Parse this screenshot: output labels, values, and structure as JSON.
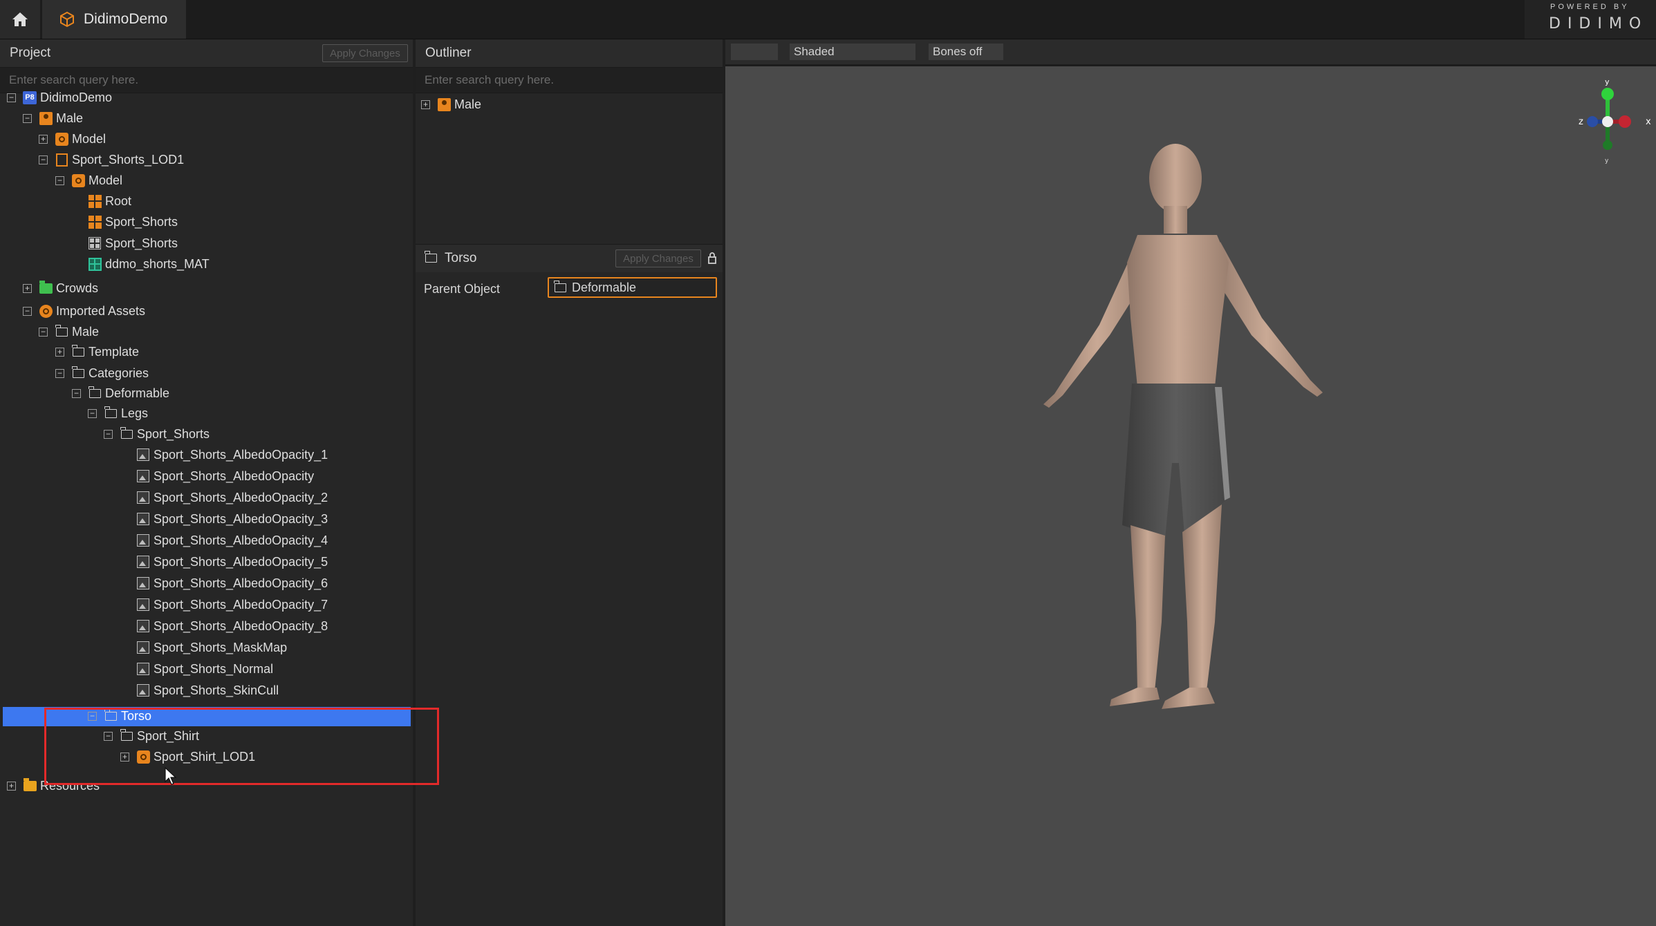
{
  "app": {
    "tab_title": "DidimoDemo",
    "brand_powered": "POWERED BY",
    "brand_logo": "DIDIMO"
  },
  "project": {
    "title": "Project",
    "apply_label": "Apply Changes",
    "search_placeholder": "Enter search query here.",
    "tree": [
      {
        "label": "DidimoDemo",
        "icon": "project-icon",
        "expander": "minus"
      },
      {
        "label": "Male",
        "icon": "character-icon",
        "expander": "minus"
      },
      {
        "label": "Model",
        "icon": "model-icon",
        "expander": "plus"
      },
      {
        "label": "Sport_Shorts_LOD1",
        "icon": "lod-icon",
        "expander": "minus"
      },
      {
        "label": "Model",
        "icon": "model-icon",
        "expander": "minus"
      },
      {
        "label": "Root",
        "icon": "joint-grid-icon"
      },
      {
        "label": "Sport_Shorts",
        "icon": "joint-grid-icon"
      },
      {
        "label": "Sport_Shorts",
        "icon": "mesh-icon"
      },
      {
        "label": "ddmo_shorts_MAT",
        "icon": "material-icon"
      },
      {
        "label": "Crowds",
        "icon": "crowds-folder-icon",
        "expander": "plus"
      },
      {
        "label": "Imported Assets",
        "icon": "imported-assets-icon",
        "expander": "minus"
      },
      {
        "label": "Male",
        "icon": "folder-icon",
        "expander": "minus"
      },
      {
        "label": "Template",
        "icon": "folder-icon",
        "expander": "plus"
      },
      {
        "label": "Categories",
        "icon": "folder-icon",
        "expander": "minus"
      },
      {
        "label": "Deformable",
        "icon": "folder-icon",
        "expander": "minus"
      },
      {
        "label": "Legs",
        "icon": "folder-icon",
        "expander": "minus"
      },
      {
        "label": "Sport_Shorts",
        "icon": "folder-icon",
        "expander": "minus"
      },
      {
        "label": "Sport_Shorts_AlbedoOpacity_1",
        "icon": "texture-icon"
      },
      {
        "label": "Sport_Shorts_AlbedoOpacity",
        "icon": "texture-icon"
      },
      {
        "label": "Sport_Shorts_AlbedoOpacity_2",
        "icon": "texture-icon"
      },
      {
        "label": "Sport_Shorts_AlbedoOpacity_3",
        "icon": "texture-icon"
      },
      {
        "label": "Sport_Shorts_AlbedoOpacity_4",
        "icon": "texture-icon"
      },
      {
        "label": "Sport_Shorts_AlbedoOpacity_5",
        "icon": "texture-icon"
      },
      {
        "label": "Sport_Shorts_AlbedoOpacity_6",
        "icon": "texture-icon"
      },
      {
        "label": "Sport_Shorts_AlbedoOpacity_7",
        "icon": "texture-icon"
      },
      {
        "label": "Sport_Shorts_AlbedoOpacity_8",
        "icon": "texture-icon"
      },
      {
        "label": "Sport_Shorts_MaskMap",
        "icon": "texture-icon"
      },
      {
        "label": "Sport_Shorts_Normal",
        "icon": "texture-icon"
      },
      {
        "label": "Sport_Shorts_SkinCull",
        "icon": "texture-icon"
      },
      {
        "label": "Torso",
        "icon": "folder-icon",
        "expander": "minus",
        "selected": true
      },
      {
        "label": "Sport_Shirt",
        "icon": "folder-icon",
        "expander": "minus"
      },
      {
        "label": "Sport_Shirt_LOD1",
        "icon": "model-icon",
        "expander": "plus"
      },
      {
        "label": "Resources",
        "icon": "resources-folder-icon",
        "expander": "plus"
      }
    ]
  },
  "outliner": {
    "title": "Outliner",
    "search_placeholder": "Enter search query here.",
    "items": [
      {
        "label": "Male",
        "icon": "character-icon",
        "expander": "plus"
      }
    ]
  },
  "properties": {
    "title": "Torso",
    "apply_label": "Apply Changes",
    "fields": [
      {
        "label": "Parent Object",
        "value": "Deformable"
      }
    ]
  },
  "viewport": {
    "toolbar": {
      "empty_btn": "",
      "shading": "Shaded",
      "bones": "Bones off"
    },
    "gizmo": {
      "x": "x",
      "y": "y",
      "z": "z"
    }
  },
  "colors": {
    "accent_orange": "#e8851e",
    "selection_blue": "#3d78f0",
    "highlight_red": "#e22a2a",
    "viewport_bg": "#4a4a4a"
  }
}
